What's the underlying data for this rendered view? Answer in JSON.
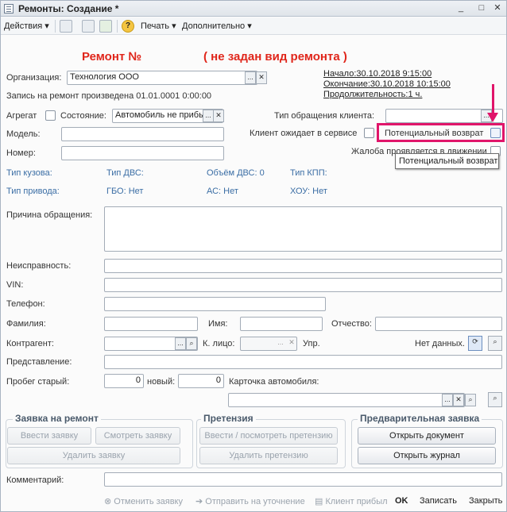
{
  "window": {
    "title": "Ремонты: Создание *",
    "minimize": "_",
    "maximize": "□",
    "close": "✕"
  },
  "toolbar": {
    "actions": "Действия",
    "print": "Печать",
    "more": "Дополнительно"
  },
  "header": {
    "repair_title": "Ремонт №",
    "repair_kind": "( не задан вид ремонта )"
  },
  "times": {
    "start": "Начало:30.10.2018 9:15:00",
    "end": "Окончание:30.10.2018 10:15:00",
    "duration": "Продолжительность:1 ч."
  },
  "org": {
    "label": "Организация:",
    "value": "Технология ООО",
    "record_info": "Запись на ремонт произведена 01.01.0001 0:00:00"
  },
  "unit": {
    "label": "Агрегат",
    "state_label": "Состояние:",
    "state_value": "Автомобиль не прибы"
  },
  "client": {
    "request_type_label": "Тип обращения клиента:",
    "waits_label": "Клиент ожидает в сервисе",
    "potential_return_label": "Потенциальный возврат",
    "complaint_label": "Жалоба проявляется в движении",
    "tooltip": "Потенциальный возврат"
  },
  "car": {
    "model_label": "Модель:",
    "number_label": "Номер:"
  },
  "specs": {
    "body_type": "Тип кузова:",
    "engine_type": "Тип ДВС:",
    "engine_volume": "Объём ДВС: 0",
    "gearbox_type": "Тип КПП:",
    "drive_type": "Тип привода:",
    "gbo": "ГБО: Нет",
    "ac": "АС: Нет",
    "hou": "ХОУ: Нет"
  },
  "form": {
    "reason_label": "Причина обращения:",
    "fault_label": "Неисправность:",
    "vin_label": "VIN:",
    "phone_label": "Телефон:",
    "lastname_label": "Фамилия:",
    "firstname_label": "Имя:",
    "middlename_label": "Отчество:",
    "contractor_label": "Контрагент:",
    "contact_label": "К. лицо:",
    "manage_label": "Упр.",
    "nodata_label": "Нет данных.",
    "representation_label": "Представление:",
    "mileage_old_label": "Пробег старый:",
    "mileage_old_value": "0",
    "mileage_new_label": "новый:",
    "mileage_new_value": "0",
    "car_card_label": "Карточка автомобиля:",
    "comment_label": "Комментарий:"
  },
  "groups": {
    "request": {
      "title": "Заявка на ремонт",
      "enter": "Ввести заявку",
      "view": "Смотреть заявку",
      "delete": "Удалить заявку"
    },
    "claim": {
      "title": "Претензия",
      "enter": "Ввести / посмотреть претензию",
      "delete": "Удалить претензию"
    },
    "pre": {
      "title": "Предварительная заявка",
      "open_doc": "Открыть документ",
      "open_journal": "Открыть журнал"
    }
  },
  "bottom": {
    "cancel": "Отменить заявку",
    "send": "Отправить на уточнение",
    "arrived": "Клиент прибыл",
    "ok": "OK",
    "save": "Записать",
    "close": "Закрыть"
  }
}
